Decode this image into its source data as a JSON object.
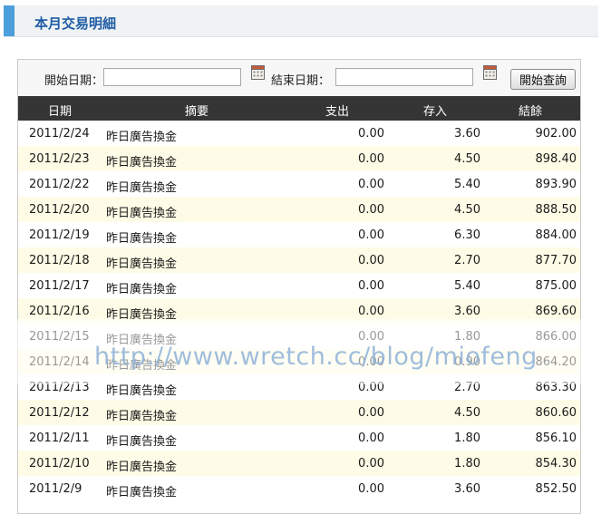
{
  "page": {
    "title": "本月交易明細"
  },
  "search": {
    "start_label": "開始日期：",
    "end_label": "結束日期：",
    "start_value": "",
    "end_value": "",
    "button_label": "開始查詢"
  },
  "table": {
    "headers": {
      "date": "日期",
      "desc": "摘要",
      "out": "支出",
      "in": "存入",
      "balance": "結餘"
    },
    "rows": [
      {
        "date": "2011/2/24",
        "desc": "昨日廣告換金",
        "out": "0.00",
        "in": "3.60",
        "balance": "902.00"
      },
      {
        "date": "2011/2/23",
        "desc": "昨日廣告換金",
        "out": "0.00",
        "in": "4.50",
        "balance": "898.40"
      },
      {
        "date": "2011/2/22",
        "desc": "昨日廣告換金",
        "out": "0.00",
        "in": "5.40",
        "balance": "893.90"
      },
      {
        "date": "2011/2/20",
        "desc": "昨日廣告換金",
        "out": "0.00",
        "in": "4.50",
        "balance": "888.50"
      },
      {
        "date": "2011/2/19",
        "desc": "昨日廣告換金",
        "out": "0.00",
        "in": "6.30",
        "balance": "884.00"
      },
      {
        "date": "2011/2/18",
        "desc": "昨日廣告換金",
        "out": "0.00",
        "in": "2.70",
        "balance": "877.70"
      },
      {
        "date": "2011/2/17",
        "desc": "昨日廣告換金",
        "out": "0.00",
        "in": "5.40",
        "balance": "875.00"
      },
      {
        "date": "2011/2/16",
        "desc": "昨日廣告換金",
        "out": "0.00",
        "in": "3.60",
        "balance": "869.60"
      },
      {
        "date": "2011/2/15",
        "desc": "昨日廣告換金",
        "out": "0.00",
        "in": "1.80",
        "balance": "866.00"
      },
      {
        "date": "2011/2/14",
        "desc": "昨日廣告換金",
        "out": "0.00",
        "in": "0.90",
        "balance": "864.20"
      },
      {
        "date": "2011/2/13",
        "desc": "昨日廣告換金",
        "out": "0.00",
        "in": "2.70",
        "balance": "863.30"
      },
      {
        "date": "2011/2/12",
        "desc": "昨日廣告換金",
        "out": "0.00",
        "in": "4.50",
        "balance": "860.60"
      },
      {
        "date": "2011/2/11",
        "desc": "昨日廣告換金",
        "out": "0.00",
        "in": "1.80",
        "balance": "856.10"
      },
      {
        "date": "2011/2/10",
        "desc": "昨日廣告換金",
        "out": "0.00",
        "in": "1.80",
        "balance": "854.30"
      },
      {
        "date": "2011/2/9",
        "desc": "昨日廣告換金",
        "out": "0.00",
        "in": "3.60",
        "balance": "852.50"
      }
    ]
  },
  "watermark": {
    "text": "http://www.wretch.cc/blog/miofeng"
  },
  "colors": {
    "accent": "#4c9fdb",
    "title": "#1f5da5",
    "header_bg": "#353535",
    "stripe": "#fefce6"
  }
}
